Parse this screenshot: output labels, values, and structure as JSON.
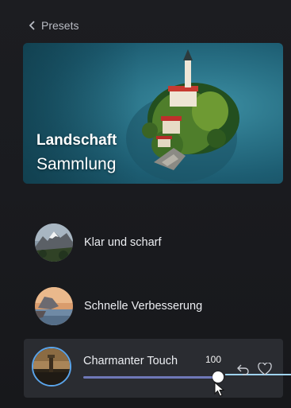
{
  "back": {
    "label": "Presets"
  },
  "hero": {
    "title": "Landschaft",
    "subtitle": "Sammlung"
  },
  "presets": [
    {
      "label": "Klar und scharf"
    },
    {
      "label": "Schnelle Verbesserung"
    }
  ],
  "active_preset": {
    "label": "Charmanter Touch",
    "value": "100",
    "slider_fraction": 1.0
  },
  "colors": {
    "accent": "#5aa4ea",
    "slider": "#6f78b8"
  },
  "icons": {
    "back": "chevron-left-icon",
    "undo": "undo-icon",
    "favorite": "heart-icon"
  }
}
